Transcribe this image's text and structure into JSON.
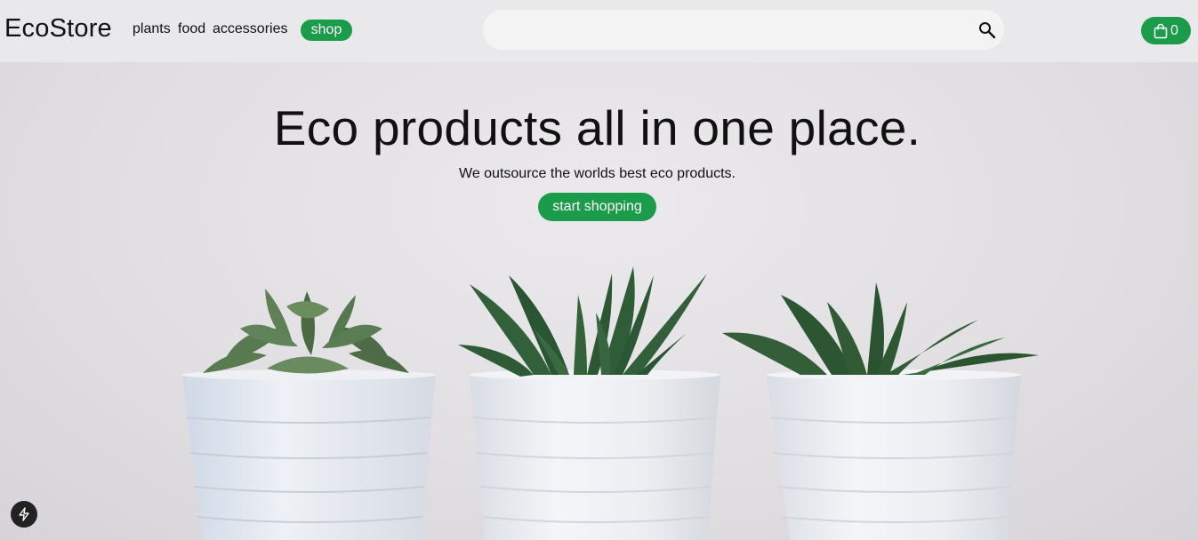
{
  "header": {
    "logo": "EcoStore",
    "nav": [
      {
        "label": "plants"
      },
      {
        "label": "food"
      },
      {
        "label": "accessories"
      }
    ],
    "shop_label": "shop",
    "search": {
      "value": "",
      "placeholder": ""
    },
    "cart_count": "0"
  },
  "hero": {
    "title": "Eco products all in one place.",
    "subtitle": "We outsource the worlds best eco products.",
    "cta_label": "start shopping"
  },
  "colors": {
    "accent": "#1a9c4a",
    "header_bg": "#e9e8ea",
    "search_bg": "#f3f3f3"
  },
  "icons": {
    "search": "search-icon",
    "cart": "shopping-bag-icon",
    "devtools": "lightning-icon"
  }
}
